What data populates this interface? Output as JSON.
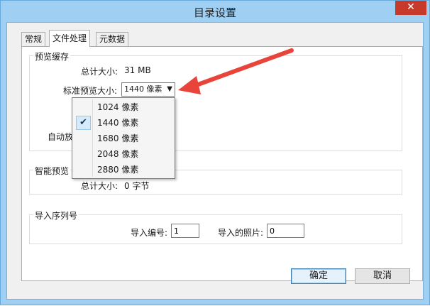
{
  "window": {
    "title": "目录设置",
    "close_glyph": "✕"
  },
  "tabs": [
    {
      "label": "常规",
      "active": false
    },
    {
      "label": "文件处理",
      "active": true
    },
    {
      "label": "元数据",
      "active": false
    }
  ],
  "preview_cache": {
    "group_label": "预览缓存",
    "total_size_label": "总计大小:",
    "total_size_value": "31 MB",
    "standard_size_label": "标准预览大小:",
    "standard_size_value": "1440 像素",
    "auto_label_partial": "自动放"
  },
  "size_dropdown": {
    "options": [
      {
        "label": "1024 像素",
        "checked": false
      },
      {
        "label": "1440 像素",
        "checked": true
      },
      {
        "label": "1680 像素",
        "checked": false
      },
      {
        "label": "2048 像素",
        "checked": false
      },
      {
        "label": "2880 像素",
        "checked": false
      }
    ],
    "check_glyph": "✔"
  },
  "smart_preview": {
    "group_label": "智能预览",
    "total_size_label": "总计大小:",
    "total_size_value": "0 字节"
  },
  "import_sequence": {
    "group_label": "导入序列号",
    "import_number_label": "导入编号:",
    "import_number_value": "1",
    "imported_photos_label": "导入的照片:",
    "imported_photos_value": "0"
  },
  "buttons": {
    "ok": "确定",
    "cancel": "取消"
  },
  "colors": {
    "annotation_arrow": "#e8443a",
    "close_button": "#c73a2b",
    "title_bar": "#9fd0f3"
  }
}
